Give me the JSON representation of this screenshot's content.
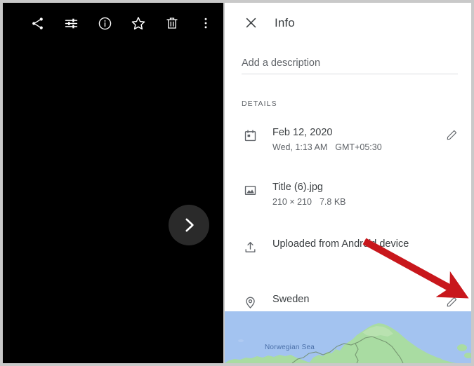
{
  "viewer": {
    "toolbar": [
      {
        "name": "share-icon",
        "label": "Share"
      },
      {
        "name": "tune-icon",
        "label": "Edit"
      },
      {
        "name": "info-icon",
        "label": "Info"
      },
      {
        "name": "star-icon",
        "label": "Favorite"
      },
      {
        "name": "trash-icon",
        "label": "Delete"
      },
      {
        "name": "more-vert-icon",
        "label": "More options"
      }
    ],
    "next_button_label": "Next photo"
  },
  "info": {
    "title": "Info",
    "close_label": "Close",
    "description": {
      "value": "",
      "placeholder": "Add a description"
    },
    "section_label": "DETAILS",
    "rows": [
      {
        "icon": "calendar-icon",
        "primary": "Feb 12, 2020",
        "secondary_day_time": "Wed, 1:13 AM",
        "secondary_timezone": "GMT+05:30",
        "has_edit": true
      },
      {
        "icon": "image-icon",
        "primary": "Title (6).jpg",
        "secondary_dimensions": "210 × 210",
        "secondary_size": "7.8 KB",
        "has_edit": false
      },
      {
        "icon": "upload-icon",
        "primary": "Uploaded from Android device",
        "has_edit": false
      },
      {
        "icon": "location-pin-icon",
        "primary": "Sweden",
        "has_edit": true
      }
    ]
  },
  "map": {
    "label": "Norwegian Sea",
    "water_color": "#a3c3f0",
    "land_color": "#a9dca2"
  },
  "annotation": {
    "arrow_color": "#c8171c",
    "description": "red arrow pointing to location edit pencil"
  }
}
